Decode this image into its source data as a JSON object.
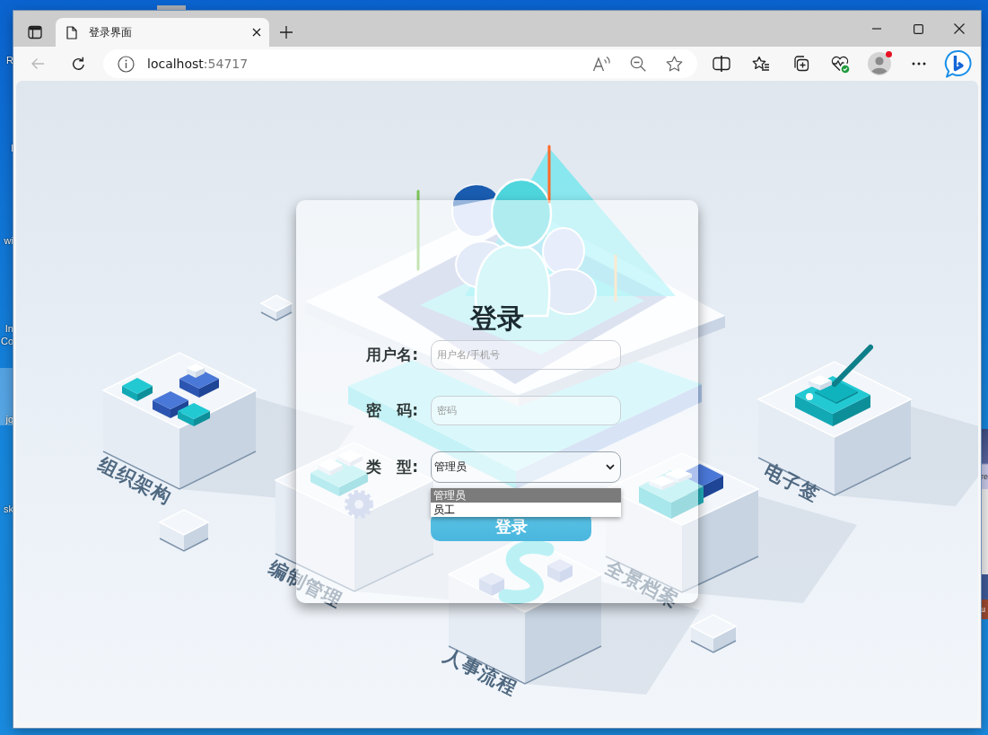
{
  "desktop": {
    "icons": [
      {
        "label": "R",
        "selected": false
      },
      {
        "label": "I",
        "selected": false
      },
      {
        "label": "wi",
        "selected": false
      },
      {
        "label": "In Co",
        "selected": false
      },
      {
        "label": "jq",
        "selected": true
      },
      {
        "label": "sk",
        "selected": false
      }
    ],
    "edge_texts": [
      "re",
      "u"
    ]
  },
  "browser": {
    "tabs": [
      {
        "title": "登录界面",
        "selected": true
      }
    ],
    "back": {
      "disabled": true
    },
    "address": {
      "host": "localhost",
      "port": ":54717"
    },
    "profile_notification": true
  },
  "login": {
    "title": "登录",
    "fields": [
      {
        "kind": "input",
        "label": "用户名:",
        "placeholder": "用户名/手机号"
      },
      {
        "kind": "input",
        "label": "密　码:",
        "placeholder": "密码"
      },
      {
        "kind": "select",
        "label": "类　型:",
        "value": "管理员",
        "expanded": true,
        "options": [
          {
            "label": "管理员",
            "selected": true
          },
          {
            "label": "员工",
            "selected": false
          }
        ]
      }
    ],
    "submit": "登录"
  },
  "illustration": {
    "labels": [
      "组织架构",
      "编制管理",
      "人事流程",
      "全景档案",
      "电子签"
    ]
  }
}
